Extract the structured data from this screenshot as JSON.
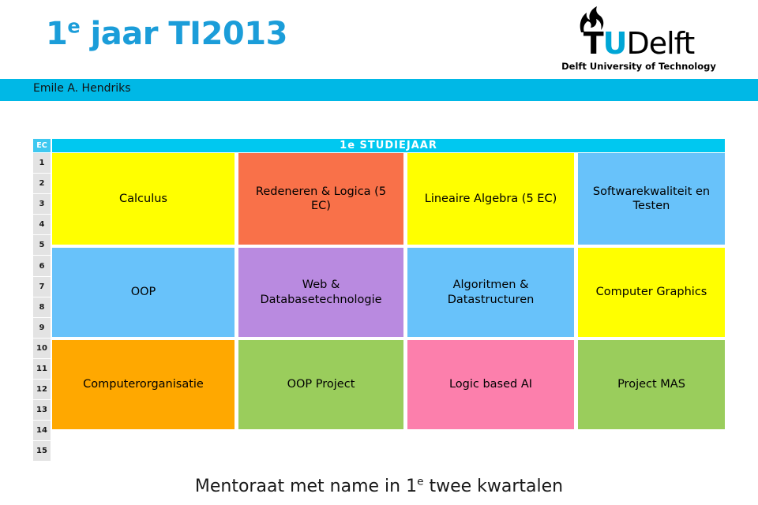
{
  "header": {
    "title_main": "1",
    "title_sup": "e",
    "title_rest": " jaar TI2013",
    "author": "Emile A. Hendriks",
    "logo": {
      "flame_icon": "tudelft-flame-icon",
      "word_t": "T",
      "word_u": "U",
      "word_delft": "Delft",
      "subtitle": "Delft University of Technology"
    },
    "accent_color": "#1b9dd9",
    "bar_color": "#00b8e6"
  },
  "table": {
    "ec_header": "EC",
    "ec_rows": [
      "1",
      "2",
      "3",
      "4",
      "5",
      "6",
      "7",
      "8",
      "9",
      "10",
      "11",
      "12",
      "13",
      "14",
      "15"
    ],
    "year_header": "1e  STUDIEJAAR",
    "bands": [
      {
        "name": "band-1",
        "cells": [
          {
            "label": "Calculus",
            "color": "#ffff00"
          },
          {
            "label": "Redeneren & Logica (5 EC)",
            "color": "#f97149"
          },
          {
            "label": "Lineaire Algebra (5 EC)",
            "color": "#ffff00"
          },
          {
            "label": "Softwarekwaliteit en Testen",
            "color": "#68c2fa"
          }
        ]
      },
      {
        "name": "band-2",
        "cells": [
          {
            "label": "OOP",
            "color": "#68c2fa"
          },
          {
            "label": "Web & Databasetechnologie",
            "color": "#b98ae0"
          },
          {
            "label": "Algoritmen & Datastructuren",
            "color": "#68c2fa"
          },
          {
            "label": "Computer Graphics",
            "color": "#ffff00"
          }
        ]
      },
      {
        "name": "band-3",
        "cells": [
          {
            "label": "Computerorganisatie",
            "color": "#ffa800"
          },
          {
            "label": "OOP Project",
            "color": "#9acd5c"
          },
          {
            "label": "Logic based AI",
            "color": "#fc7fac"
          },
          {
            "label": "Project MAS",
            "color": "#9acd5c"
          }
        ]
      }
    ]
  },
  "footer": {
    "caption_pre": "Mentoraat  met name in 1",
    "caption_sup": "e",
    "caption_post": " twee kwartalen"
  }
}
